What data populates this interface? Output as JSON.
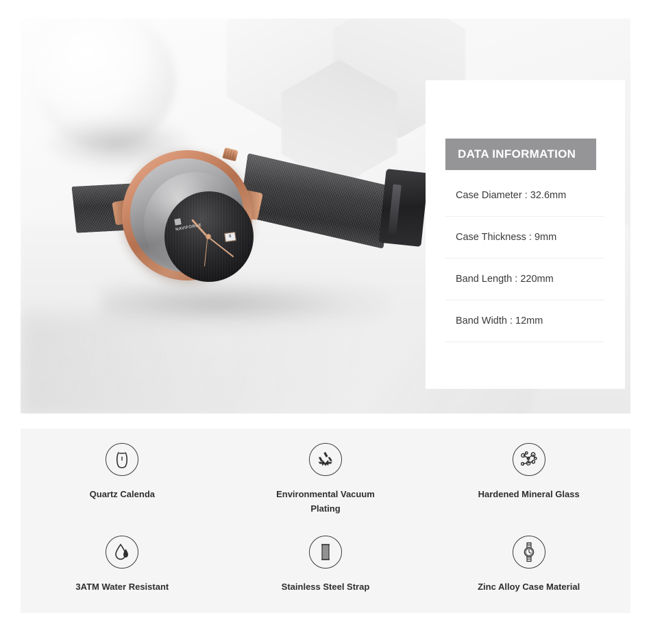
{
  "product": {
    "brand_on_dial": "NAVIFORCE",
    "dial_date": "8"
  },
  "data_panel": {
    "header": "DATA INFORMATION",
    "rows": [
      {
        "label": "Case Diameter",
        "value": "32.6mm",
        "text": "Case Diameter : 32.6mm"
      },
      {
        "label": "Case Thickness",
        "value": "9mm",
        "text": "Case Thickness : 9mm"
      },
      {
        "label": "Band Length",
        "value": "220mm",
        "text": "Band Length : 220mm"
      },
      {
        "label": "Band Width",
        "value": "12mm",
        "text": "Band Width : 12mm"
      }
    ]
  },
  "features": [
    {
      "icon": "watch-case-icon",
      "label": "Quartz Calenda"
    },
    {
      "icon": "recycle-icon",
      "label": "Environmental Vacuum Plating"
    },
    {
      "icon": "molecule-icon",
      "label": "Hardened Mineral Glass"
    },
    {
      "icon": "water-drop-icon",
      "label": "3ATM Water Resistant"
    },
    {
      "icon": "mesh-strap-icon",
      "label": "Stainless Steel Strap"
    },
    {
      "icon": "wristwatch-icon",
      "label": "Zinc Alloy Case Material"
    }
  ],
  "colors": {
    "header_band": "#959597",
    "header_text": "#ffffff",
    "body_text": "#3a3a3a",
    "feature_bg": "#f5f5f5",
    "card_bg": "#ffffff",
    "divider": "#eeeeee",
    "icon_stroke": "#3c3c3c",
    "rose_gold": "#c1815d",
    "band_dark": "#2b2b2d"
  }
}
